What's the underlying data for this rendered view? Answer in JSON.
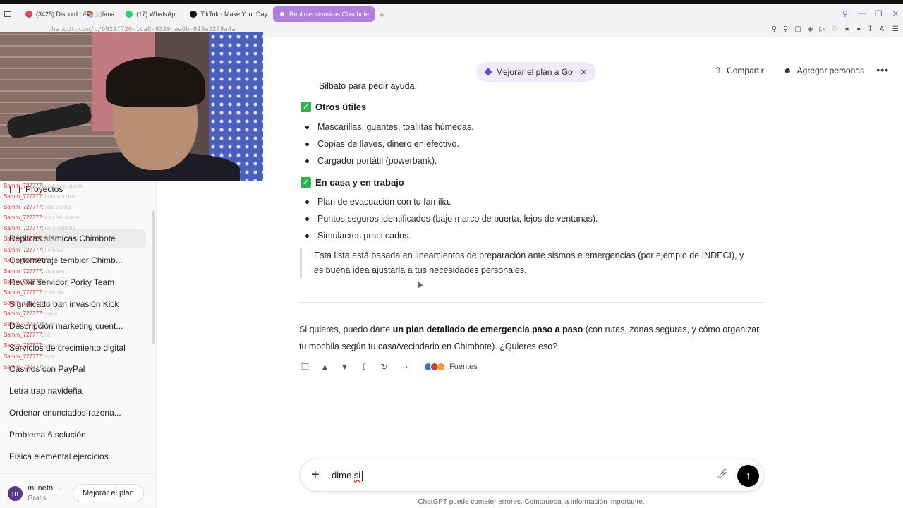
{
  "browser": {
    "tabs": [
      {
        "label": "(3425) Discord | #📚📖fana",
        "color": "#e0475b"
      },
      {
        "label": "(17) WhatsApp",
        "color": "#25d366"
      },
      {
        "label": "TikTok - Make Your Day",
        "color": "#111111"
      },
      {
        "label": "Réplicas sísmicas Chimbote",
        "color": "#ffffff",
        "active": true
      }
    ],
    "url": "chatgpt.com/c/6921f720-1ca8-8320-ae6b-918e32f8a4a"
  },
  "sidebar": {
    "projects_label": "Proyectos",
    "chats": [
      {
        "label": "Réplicas sísmicas Chimbote",
        "active": true
      },
      {
        "label": "Cortometraje temblor Chimb..."
      },
      {
        "label": "Revivir servidor Porky Team"
      },
      {
        "label": "Significado ban invasión Kick"
      },
      {
        "label": "Descripción marketing cuent..."
      },
      {
        "label": "Servicios de crecimiento digital"
      },
      {
        "label": "Casinos con PayPal"
      },
      {
        "label": "Letra trap navideña"
      },
      {
        "label": "Ordenar enunciados razona..."
      },
      {
        "label": "Problema 6 solución"
      },
      {
        "label": "Física elemental ejercicios"
      }
    ],
    "user": {
      "initial": "m",
      "name": "mi neto ...",
      "plan": "Gratis"
    },
    "upgrade_label": "Mejorar el plan"
  },
  "stream_chat": [
    {
      "user": "Samm_727777:",
      "msg": "ya no se puede"
    },
    {
      "user": "Samm_727777:",
      "msg": "hola a todos"
    },
    {
      "user": "Samm_727777:",
      "msg": "que sismo"
    },
    {
      "user": "Samm_727777:",
      "msg": "eso fue fuerte"
    },
    {
      "user": "Samm_727777:",
      "msg": "en chimbote"
    },
    {
      "user": "Samm_727777:",
      "msg": "alerta"
    },
    {
      "user": "Samm_727777:",
      "msg": "tiembla"
    },
    {
      "user": "Samm_727777:",
      "msg": "cuidado"
    },
    {
      "user": "Samm_727777:",
      "msg": "ya paso"
    },
    {
      "user": "Samm_727777:",
      "msg": "saludos"
    },
    {
      "user": "Samm_727777:",
      "msg": "mochila"
    },
    {
      "user": "Samm_727777:",
      "msg": "linterna"
    },
    {
      "user": "Samm_727777:",
      "msg": "agua"
    },
    {
      "user": "Samm_727777:",
      "msg": "radio"
    },
    {
      "user": "Samm_727777:",
      "msg": "ok"
    },
    {
      "user": "Samm_727777:",
      "msg": "gracias"
    },
    {
      "user": "Samm_727777:",
      "msg": "bye"
    },
    {
      "user": "Samm_727777:",
      "msg": "jaja"
    }
  ],
  "header": {
    "plan_pill": "Mejorar el plan a Go",
    "share": "Compartir",
    "add_people": "Agregar personas",
    "more": "•••"
  },
  "content": {
    "cut_line": "Silbato para pedir ayuda.",
    "sections": [
      {
        "title": "Otros útiles",
        "items": [
          "Mascarillas, guantes, toallitas húmedas.",
          "Copias de llaves, dinero en efectivo.",
          "Cargador portátil (powerbank)."
        ]
      },
      {
        "title": "En casa y en trabajo",
        "items": [
          "Plan de evacuación con tu familia.",
          "Puntos seguros identificados (bajo marco de puerta, lejos de ventanas).",
          "Simulacros practicados."
        ]
      }
    ],
    "quote": "Esta lista está basada en lineamientos de preparación ante sismos e emergencias (por ejemplo de INDECI), y es buena idea ajustarla a tus necesidades personales.",
    "followup_pre": "Si quieres, puedo darte ",
    "followup_bold": "un plan detallado de emergencia paso a paso",
    "followup_post": " (con rutas, zonas seguras, y cómo organizar tu mochila según tu casa/vecindario en Chimbote). ¿Quieres eso?",
    "sources_label": "Fuentes"
  },
  "composer": {
    "text_pre": "dime ",
    "text_misspelled": "si",
    "disclaimer": "ChatGPT puede cometer errores. Comprueba la información importante."
  }
}
